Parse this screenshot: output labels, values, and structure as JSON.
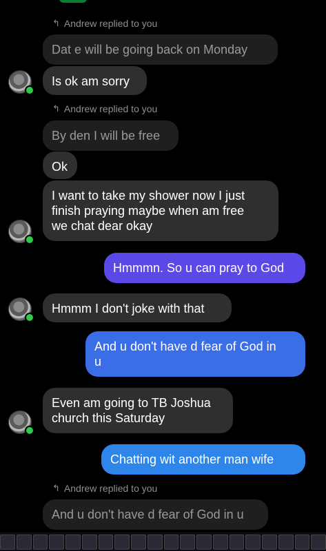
{
  "messages": {
    "reply_label_1": "Andrew replied to you",
    "quoted_1": "Dat e will be going back on Monday",
    "msg_1": "Is ok am sorry",
    "reply_label_2": "Andrew replied to you",
    "quoted_2": "By den I will be free",
    "msg_2": "Ok",
    "msg_3": "I want to take my shower now I just\nfinish praying maybe when am free\nwe chat dear okay",
    "out_1": "Hmmmn. So u can pray to God",
    "msg_4": "Hmmm I don't joke with that",
    "out_2": "And u don't have d fear of God in\nu",
    "msg_5": "Even am going to TB Joshua\nchurch this Saturday",
    "out_3": "Chatting wit another man wife",
    "reply_label_3": "Andrew replied to you",
    "quoted_3": "And u don't have d fear of God in u"
  },
  "colors": {
    "background": "#000000",
    "incoming_bubble": "#2f2f30",
    "quoted_bubble": "#1f1f20",
    "outgoing_bubble_1": "#5a49e6",
    "outgoing_bubble_2": "#3b6ee6",
    "outgoing_bubble_3": "#2f86ea",
    "online_indicator": "#31c94a"
  },
  "icons": {
    "reply": "reply-arrow-icon",
    "avatar": "user-avatar",
    "presence": "online-dot-icon"
  }
}
